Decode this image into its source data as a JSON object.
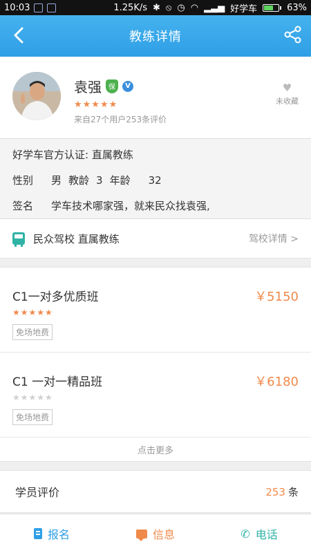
{
  "status_bar": {
    "time": "10:03",
    "network_speed": "1.25K/s",
    "carrier": "好学车",
    "battery_level": "63%"
  },
  "nav": {
    "title": "教练详情",
    "back_icon": "back-arrow-icon",
    "share_icon": "share-icon"
  },
  "coach": {
    "name": "袁强",
    "badge_shield": "保",
    "badge_v": "V",
    "stars": "★★★★★",
    "review_source": "来自27个用户253条评价",
    "favorite_label": "未收藏"
  },
  "info": {
    "certification_label": "好学车官方认证:",
    "certification_value": "直属教练",
    "gender_label": "性别",
    "gender_value": "男",
    "teaching_age_label": "教龄",
    "teaching_age_value": "3",
    "age_label": "年龄",
    "age_value": "32",
    "signature_label": "签名",
    "signature_value": "学车技术哪家强，就来民众找袁强,"
  },
  "school": {
    "name": "民众驾校 直属教练",
    "detail_link": "驾校详情 >"
  },
  "classes": [
    {
      "name": "C1一对多优质班",
      "price": "￥5150",
      "stars": "★★★★★",
      "rated": true,
      "tag": "免场地费"
    },
    {
      "name": "C1 一对一精品班",
      "price": "￥6180",
      "stars": "★★★★★",
      "rated": false,
      "tag": "免场地费"
    }
  ],
  "more_label": "点击更多",
  "reviews": {
    "label": "学员评价",
    "count": "253",
    "unit": "条"
  },
  "bottom_bar": {
    "signup": "报名",
    "message": "信息",
    "phone": "电话"
  },
  "colors": {
    "brand_blue": "#2f9fe6",
    "accent_orange": "#f08a4b",
    "teal": "#2fb3a5"
  }
}
